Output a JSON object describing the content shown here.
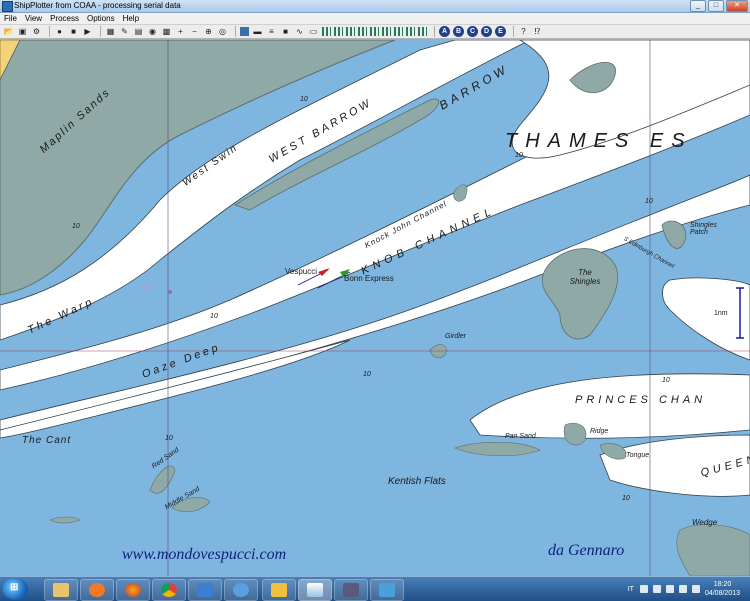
{
  "window": {
    "title": "ShipPlotter from COAA - processing serial data",
    "buttons": [
      "_",
      "□",
      "✕"
    ]
  },
  "menu": [
    "File",
    "View",
    "Process",
    "Options",
    "Help"
  ],
  "toolbar_letters": [
    "A",
    "B",
    "C",
    "D",
    "E"
  ],
  "map": {
    "sand_labels": {
      "maplin_sands": "Maplin Sands",
      "west_swin": "West Swin",
      "west_barrow": "WEST BARROW",
      "barrow": "BARROW",
      "thames_es": "THAMES  ES",
      "knock_john_channel": "Knock John Channel",
      "knob_channel": "KNOB CHANNEL",
      "the_warp": "The Warp",
      "oaze_deep": "Oaze Deep",
      "the_shingles": "The Shingles",
      "shingles_patch": "Shingles Patch",
      "s_edinburgh_channel": "S Edinburgh Channel",
      "girdler": "Girdler",
      "princes_channel": "PRINCES  CHAN",
      "the_cant": "The Cant",
      "red_sand": "Red Sand",
      "middle_sand": "Middle Sand",
      "pan_sand": "Pan Sand",
      "ridge": "Ridge",
      "tongue": "Tongue",
      "queens": "QUEEN",
      "kentish_flats": "Kentish Flats",
      "wedge": "Wedge"
    },
    "depth_labels": [
      "10",
      "10",
      "10",
      "10",
      "10",
      "10",
      "10",
      "10",
      "10"
    ],
    "ships": {
      "vespucci": "Vespucci",
      "bonn_express": "Bonn Express",
      "mary": "Mary"
    },
    "scale_label": "1nm"
  },
  "watermark": {
    "left": "www.mondovespucci.com",
    "right": "da Gennaro"
  },
  "taskbar": {
    "language": "IT",
    "time": "18:20",
    "date": "04/08/2013"
  },
  "colors": {
    "water": "#7fb6e0",
    "channel": "#ffffff",
    "sandbank": "#8fa9a6",
    "land": "#f2d37a",
    "ship_vespucci": "#cc2222",
    "ship_bonn": "#2a9a2a",
    "grid": "#8a2a6a"
  }
}
